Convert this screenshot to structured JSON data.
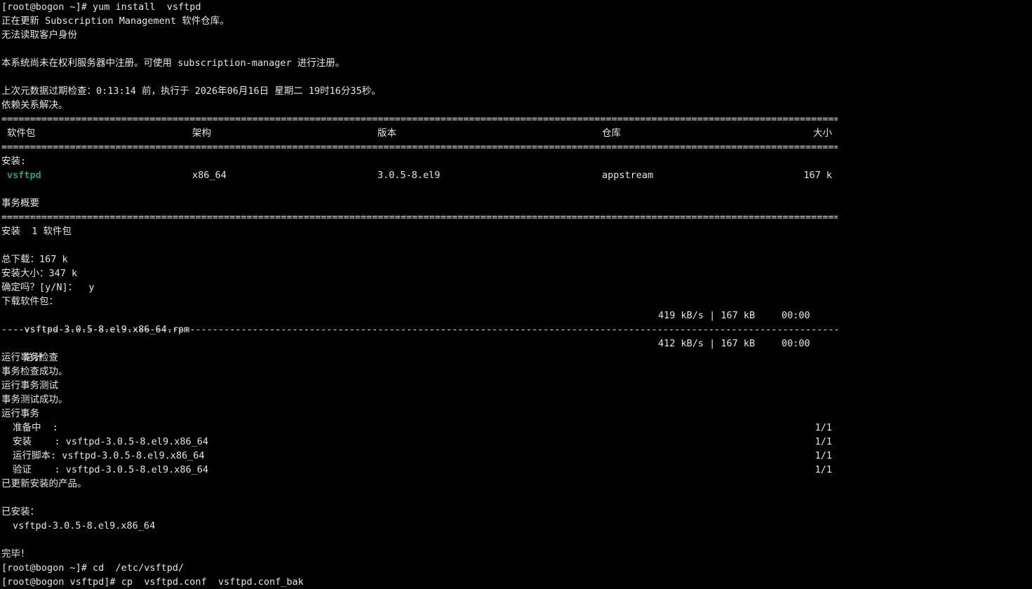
{
  "terminal": {
    "prompt1": "[root@bogon ~]# ",
    "cmd1": "yum install  vsftpd",
    "updating": "正在更新 Subscription Management 软件仓库。",
    "no_identity": "无法读取客户身份",
    "not_registered": "本系统尚未在权利服务器中注册。可使用 subscription-manager 进行注册。",
    "metadata_check": "上次元数据过期检查：0:13:14 前，执行于 2026年06月16日 星期二 19时16分35秒。",
    "deps_resolved": "依赖关系解决。",
    "separator_eq": "===============================================================================================================================================================",
    "separator_dash": "---------------------------------------------------------------------------------------------------------------------------------------------------------------",
    "table_headers": {
      "package": "软件包",
      "arch": "架构",
      "version": "版本",
      "repo": "仓库",
      "size": "大小"
    },
    "installing_label": "安装:",
    "package_row": {
      "name": "vsftpd",
      "arch": "x86_64",
      "version": "3.0.5-8.el9",
      "repo": "appstream",
      "size": "167 k"
    },
    "transaction_summary": "事务概要",
    "install_count": "安装  1 软件包",
    "total_download": "总下载：167 k",
    "installed_size": "安装大小：347 k",
    "confirm": "确定吗？[y/N]：  y",
    "downloading": "下载软件包：",
    "download_file": "vsftpd-3.0.5-8.el9.x86_64.rpm",
    "download_rate": "419 kB/s | 167 kB",
    "download_time": "00:00",
    "total_label": "总计",
    "total_rate": "412 kB/s | 167 kB",
    "total_time": "00:00",
    "run_check": "运行事务检查",
    "check_ok": "事务检查成功。",
    "run_test": "运行事务测试",
    "test_ok": "事务测试成功。",
    "run_transaction": "运行事务",
    "steps": [
      {
        "label": "准备中  :",
        "detail": "",
        "count": "1/1"
      },
      {
        "label": "安装    :",
        "detail": " vsftpd-3.0.5-8.el9.x86_64",
        "count": "1/1"
      },
      {
        "label": "运行脚本:",
        "detail": " vsftpd-3.0.5-8.el9.x86_64",
        "count": "1/1"
      },
      {
        "label": "验证    :",
        "detail": " vsftpd-3.0.5-8.el9.x86_64",
        "count": "1/1"
      }
    ],
    "updated_products": "已更新安装的产品。",
    "installed_label": "已安装：",
    "installed_pkg": "vsftpd-3.0.5-8.el9.x86_64",
    "done": "完毕！",
    "prompt2": "[root@bogon ~]# ",
    "cmd2": "cd  /etc/vsftpd/",
    "prompt3": "[root@bogon vsftpd]# ",
    "cmd3": "cp  vsftpd.conf  vsftpd.conf_bak"
  }
}
